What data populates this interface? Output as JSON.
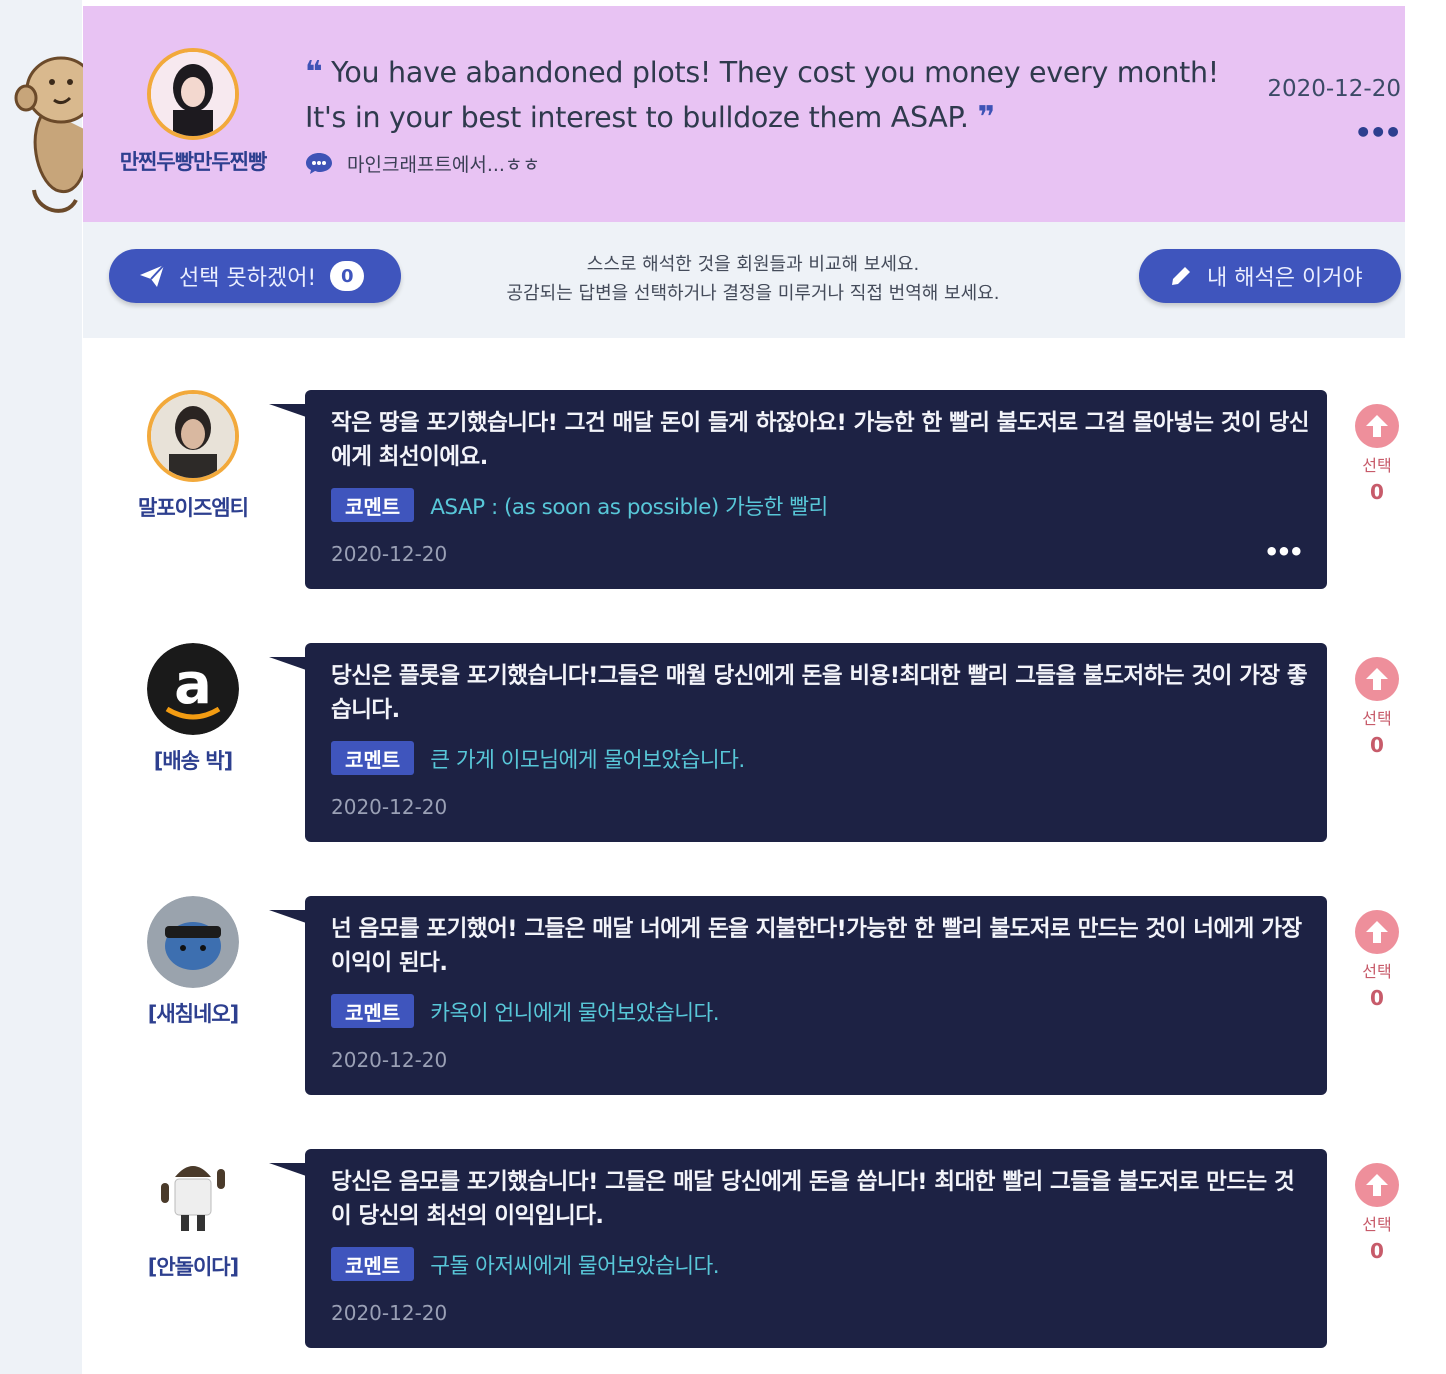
{
  "question": {
    "author": "만찐두빵만두찐빵",
    "quote_line1": "You have abandoned plots! They cost you money every month!",
    "quote_line2": "It's in your best interest to bulldoze them ASAP.",
    "open_quote": "❝",
    "close_quote": "❞",
    "source": "마인크래프트에서...ㅎㅎ",
    "date": "2020-12-20",
    "more": "•••"
  },
  "actionbar": {
    "cannot_choose_label": "선택 못하겠어!",
    "cannot_choose_count": "0",
    "guide_line1": "스스로 해석한 것을 회원들과 비교해 보세요.",
    "guide_line2": "공감되는 답변을 선택하거나 결정을 미루거나 직접 번역해 보세요.",
    "my_translation_label": "내 해석은 이거야"
  },
  "answers": [
    {
      "author": "말포이즈엠티",
      "text": "작은 땅을 포기했습니다! 그건 매달 돈이 들게 하잖아요! 가능한 한 빨리 불도저로 그걸 몰아넣는 것이 당신에게 최선이에요.",
      "comment_tag": "코멘트",
      "comment": "ASAP : (as soon as possible) 가능한 빨리",
      "date": "2020-12-20",
      "more": "•••",
      "vote_label": "선택",
      "vote_count": "0"
    },
    {
      "author": "[배송 박]",
      "text": "당신은 플롯을 포기했습니다!그들은 매월 당신에게 돈을 비용!최대한 빨리 그들을 불도저하는 것이 가장 좋습니다.",
      "comment_tag": "코멘트",
      "comment": "큰 가게 이모님에게 물어보았습니다.",
      "date": "2020-12-20",
      "vote_label": "선택",
      "vote_count": "0"
    },
    {
      "author": "[새침네오]",
      "text": "넌 음모를 포기했어! 그들은 매달 너에게 돈을 지불한다!가능한 한 빨리 불도저로 만드는 것이 너에게 가장 이익이 된다.",
      "comment_tag": "코멘트",
      "comment": "카옥이 언니에게 물어보았습니다.",
      "date": "2020-12-20",
      "vote_label": "선택",
      "vote_count": "0"
    },
    {
      "author": "[안돌이다]",
      "text": "당신은 음모를 포기했습니다! 그들은 매달 당신에게 돈을 씁니다! 최대한 빨리 그들을 불도저로 만드는 것이 당신의 최선의 이익입니다.",
      "comment_tag": "코멘트",
      "comment": "구돌 아저씨에게 물어보았습니다.",
      "date": "2020-12-20",
      "vote_label": "선택",
      "vote_count": "0"
    }
  ]
}
